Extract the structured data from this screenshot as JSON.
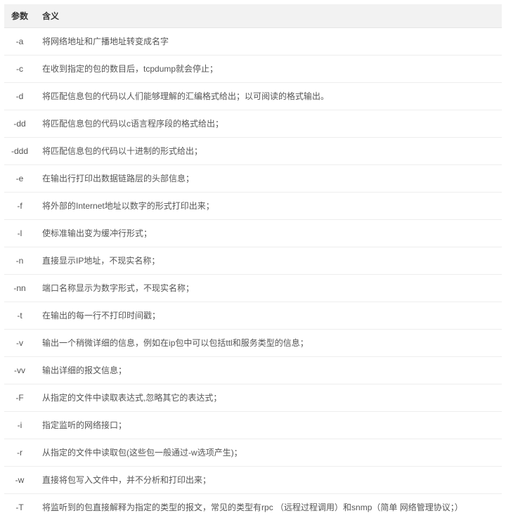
{
  "table": {
    "headers": {
      "col1": "参数",
      "col2": "含义"
    },
    "rows": [
      {
        "flag": "-a",
        "desc": "将网络地址和广播地址转变成名字"
      },
      {
        "flag": "-c",
        "desc": "在收到指定的包的数目后，tcpdump就会停止；"
      },
      {
        "flag": "-d",
        "desc": "将匹配信息包的代码以人们能够理解的汇编格式给出；以可阅读的格式输出。"
      },
      {
        "flag": "-dd",
        "desc": "将匹配信息包的代码以c语言程序段的格式给出；"
      },
      {
        "flag": "-ddd",
        "desc": "将匹配信息包的代码以十进制的形式给出；"
      },
      {
        "flag": "-e",
        "desc": "在输出行打印出数据链路层的头部信息；"
      },
      {
        "flag": "-f",
        "desc": "将外部的Internet地址以数字的形式打印出来；"
      },
      {
        "flag": "-l",
        "desc": "使标准输出变为缓冲行形式；"
      },
      {
        "flag": "-n",
        "desc": "直接显示IP地址，不现实名称；"
      },
      {
        "flag": "-nn",
        "desc": "端口名称显示为数字形式，不现实名称；"
      },
      {
        "flag": "-t",
        "desc": "在输出的每一行不打印时间戳；"
      },
      {
        "flag": "-v",
        "desc": "输出一个稍微详细的信息，例如在ip包中可以包括ttl和服务类型的信息；"
      },
      {
        "flag": "-vv",
        "desc": "输出详细的报文信息；"
      },
      {
        "flag": "-F",
        "desc": "从指定的文件中读取表达式,忽略其它的表达式；"
      },
      {
        "flag": "-i",
        "desc": "指定监听的网络接口；"
      },
      {
        "flag": "-r",
        "desc": "从指定的文件中读取包(这些包一般通过-w选项产生)；"
      },
      {
        "flag": "-w",
        "desc": "直接将包写入文件中，并不分析和打印出来；"
      },
      {
        "flag": "-T",
        "desc": "将监听到的包直接解释为指定的类型的报文，常见的类型有rpc （远程过程调用）和snmp（简单 网络管理协议；）"
      }
    ]
  }
}
